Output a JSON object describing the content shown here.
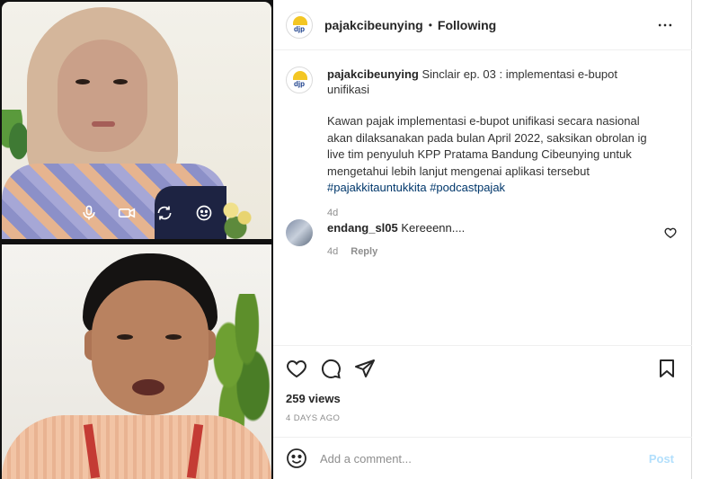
{
  "post": {
    "username": "pajakcibeunying",
    "dot": "•",
    "follow_status": "Following",
    "avatar_text": "djp",
    "caption": {
      "username": "pajakcibeunying",
      "title": "Sinclair ep. 03 : implementasi e-bupot unifikasi",
      "text": "Kawan pajak implementasi e-bupot unifikasi secara nasional akan dilaksanakan pada bulan April 2022, saksikan obrolan ig live tim penyuluh KPP Pratama Bandung Cibeunying untuk mengetahui lebih lanjut mengenai aplikasi tersebut ",
      "hashtag1": "#pajakkitauntukkita",
      "hashtag2": "#podcastpajak",
      "time": "4d"
    },
    "comments": [
      {
        "username": "endang_sl05",
        "text": "Kereeenn....",
        "time": "4d",
        "reply_label": "Reply"
      }
    ],
    "views": "259 views",
    "posted": "4 DAYS AGO",
    "comment_placeholder": "Add a comment...",
    "post_button": "Post"
  },
  "icons": {
    "more": "more-horizontal-icon",
    "heart": "heart-icon",
    "comment": "comment-icon",
    "share": "share-icon",
    "save": "bookmark-icon",
    "emoji": "emoji-icon",
    "mic": "microphone-icon",
    "camera": "video-camera-icon",
    "flip": "flip-camera-icon",
    "effects": "smiley-effects-icon"
  },
  "colors": {
    "link": "#00376b",
    "post_button_disabled": "#b2dffc",
    "muted": "#8e8e8e",
    "logo_yellow": "#f3c623",
    "logo_blue": "#1b3f8b"
  }
}
